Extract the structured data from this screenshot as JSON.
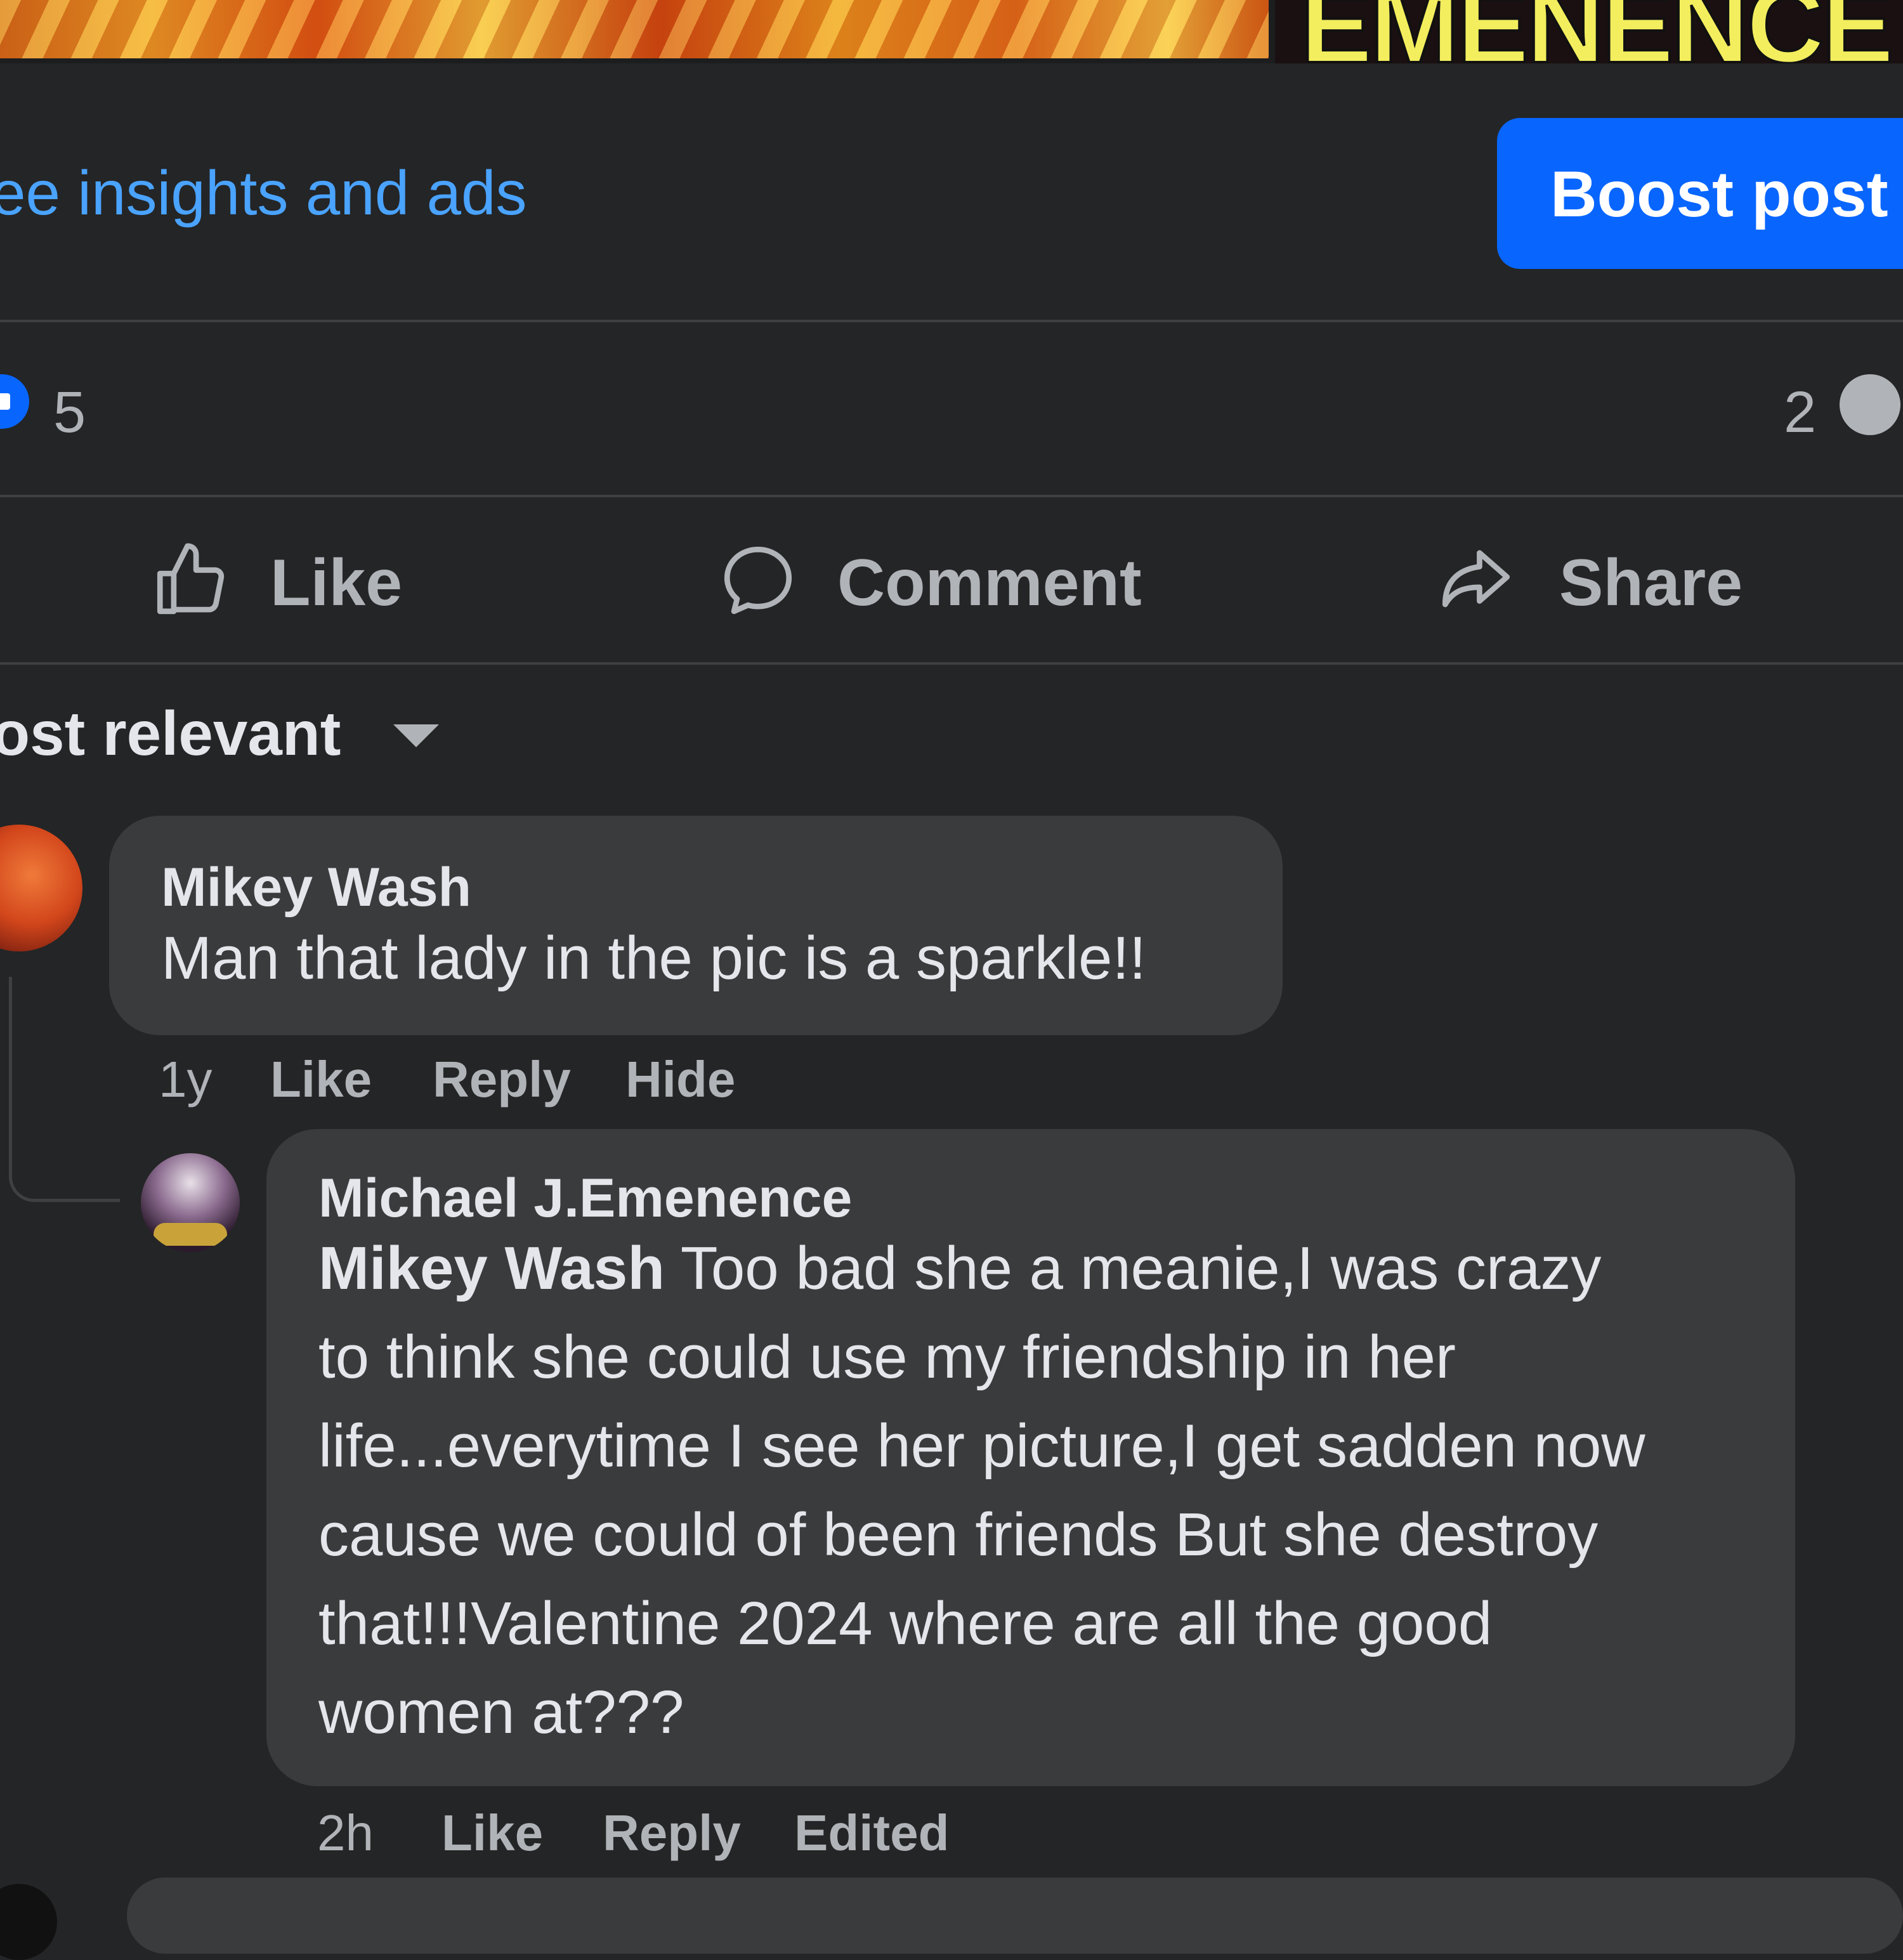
{
  "post": {
    "header_image_text": "EMENENCE",
    "insights_link": "ee insights and ads",
    "boost_button": "Boost post",
    "reaction_count": "5",
    "comment_count": "2"
  },
  "actions": {
    "like": "Like",
    "comment": "Comment",
    "share": "Share"
  },
  "sort": {
    "label": "lost relevant"
  },
  "comments": [
    {
      "author": "Mikey Wash",
      "text": "Man that lady in the pic is a sparkle!!",
      "time": "1y",
      "like": "Like",
      "reply": "Reply",
      "extra": "Hide"
    },
    {
      "author": "Michael J.Emenence",
      "mention": "Mikey Wash",
      "lines": [
        " Too bad she a meanie,I was crazy",
        "to think she could use my friendship in her",
        "life...everytime I see her picture,I get sadden now",
        "cause we could of been friends But she destroy",
        "that!!!Valentine 2024 where are all the good",
        "women at???"
      ],
      "time": "2h",
      "like": "Like",
      "reply": "Reply",
      "extra": "Edited"
    }
  ],
  "colors": {
    "background": "#242526",
    "bubble": "#3a3b3c",
    "link": "#4aa3ff",
    "primary_button": "#0866ff",
    "secondary_text": "#b0b3b8"
  }
}
